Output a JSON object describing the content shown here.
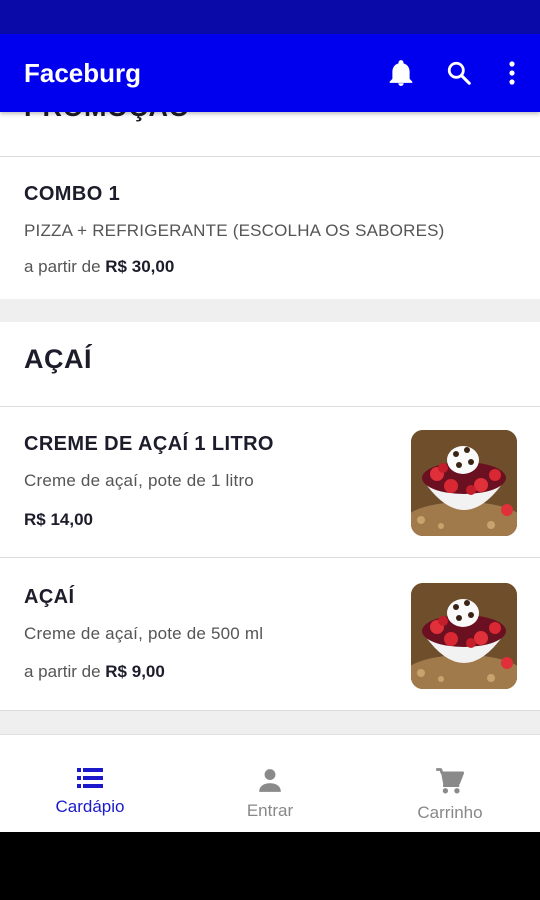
{
  "app": {
    "title": "Faceburg"
  },
  "icons": {
    "notifications": "bell-icon",
    "search": "search-icon",
    "menu": "more-vertical-icon"
  },
  "sections": [
    {
      "title": "PROMOÇÃO",
      "items": [
        {
          "name": "COMBO 1",
          "description": "PIZZA + REFRIGERANTE (ESCOLHA OS SABORES)",
          "price_prefix": "a partir de",
          "price": "R$ 30,00"
        }
      ]
    },
    {
      "title": "AÇAÍ",
      "items": [
        {
          "name": "CREME DE AÇAÍ 1 LITRO",
          "description": "Creme de açaí, pote de 1 litro",
          "price": "R$ 14,00"
        },
        {
          "name": "AÇAÍ",
          "description": "Creme de açaí, pote de 500 ml",
          "price_prefix": "a partir de",
          "price": "R$ 9,00"
        }
      ]
    }
  ],
  "bottom_nav": [
    {
      "label": "Cardápio",
      "icon": "list-icon",
      "active": true
    },
    {
      "label": "Entrar",
      "icon": "person-icon",
      "active": false
    },
    {
      "label": "Carrinho",
      "icon": "cart-icon",
      "active": false
    }
  ],
  "colors": {
    "primary": "#0000ee",
    "status_bar": "#0a0aa8",
    "active_nav": "#1a1acc"
  }
}
